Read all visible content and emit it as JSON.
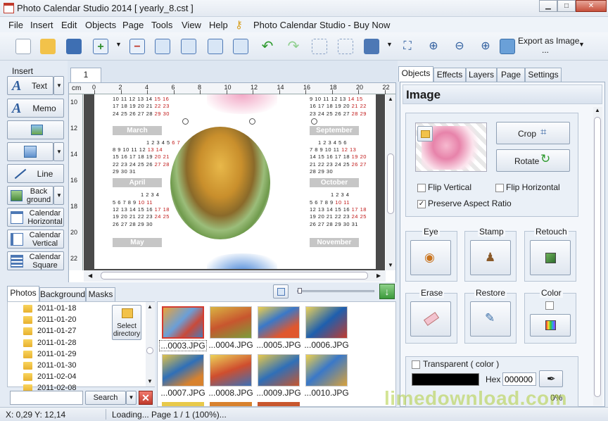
{
  "window": {
    "title": "Photo Calendar Studio 2014 [ yearly_8.cst ]",
    "buttons": {
      "minimize": "▁",
      "maximize": "□",
      "close": "✕"
    }
  },
  "menu": {
    "items": [
      "File",
      "Insert",
      "Edit",
      "Objects",
      "Page",
      "Tools",
      "View",
      "Help"
    ],
    "buy_now": "Photo Calendar Studio - Buy Now"
  },
  "toolbar": {
    "export_label": "Export as Image",
    "export_more": "..."
  },
  "insert_panel": {
    "title": "Insert",
    "text": "Text",
    "memo": "Memo",
    "line": "Line",
    "background": "Back ground",
    "cal_horizontal": "Calendar Horizontal",
    "cal_vertical": "Calendar Vertical",
    "cal_square": "Calendar Square"
  },
  "canvas": {
    "page_tab": "1",
    "ruler_unit": "cm",
    "ruler_ticks": [
      "0",
      "2",
      "4",
      "6",
      "8",
      "10",
      "12",
      "14",
      "16",
      "18",
      "20",
      "22"
    ],
    "ruler_v_ticks": [
      "10",
      "12",
      "14",
      "16",
      "18",
      "20",
      "22"
    ],
    "left_months": {
      "top_rows": [
        "10 11 12 13 14 15 16",
        "17 18 19 20 21 22 23",
        "24 25 26 27 28 29 30"
      ],
      "march": {
        "name": "March",
        "rows": [
          "1 2 3 4 5 6 7",
          "8 9 10 11 12 13 14",
          "15 16 17 18 19 20 21",
          "22 23 24 25 26 27 28",
          "29 30 31"
        ]
      },
      "april": {
        "name": "April",
        "rows": [
          "1 2 3 4",
          "5 6 7 8 9 10 11",
          "12 13 14 15 16 17 18",
          "19 20 21 22 23 24 25",
          "26 27 28 29 30"
        ]
      },
      "may": {
        "name": "May"
      }
    },
    "right_months": {
      "top_rows": [
        "9 10 11 12 13 14 15",
        "16 17 18 19 20 21 22",
        "23 24 25 26 27 28 29"
      ],
      "september": {
        "name": "September",
        "rows": [
          "1 2 3 4 5 6",
          "7 8 9 10 11 12 13",
          "14 15 16 17 18 19 20",
          "21 22 23 24 25 26 27",
          "28 29 30"
        ]
      },
      "october": {
        "name": "October",
        "rows": [
          "1 2 3 4",
          "5 6 7 8 9 10 11",
          "12 13 14 15 16 17 18",
          "19 20 21 22 23 24 25",
          "26 27 28 29 30 31"
        ]
      },
      "november": {
        "name": "November"
      }
    }
  },
  "bottom": {
    "tabs": [
      "Photos",
      "Background",
      "Masks"
    ],
    "folders": [
      "2011-01-18",
      "2011-01-20",
      "2011-01-27",
      "2011-01-28",
      "2011-01-29",
      "2011-01-30",
      "2011-02-04",
      "2011-02-08"
    ],
    "select_directory": "Select directory",
    "search_button": "Search",
    "search_value": "",
    "thumbnails": [
      "...0003.JPG",
      "...0004.JPG",
      "...0005.JPG",
      "...0006.JPG",
      "...0007.JPG",
      "...0008.JPG",
      "...0009.JPG",
      "...0010.JPG"
    ]
  },
  "right_panel": {
    "tabs": [
      "Objects",
      "Effects",
      "Layers",
      "Page",
      "Settings"
    ],
    "heading": "Image",
    "crop": "Crop",
    "rotate": "Rotate",
    "flip_vertical": "Flip Vertical",
    "flip_horizontal": "Flip Horizontal",
    "preserve_aspect": "Preserve Aspect Ratio",
    "preserve_checked": true,
    "eye": "Eye",
    "stamp": "Stamp",
    "retouch": "Retouch",
    "erase": "Erase",
    "restore": "Restore",
    "color": "Color",
    "transparent": "Transparent ( color )",
    "hex_label": "Hex",
    "hex_value": "000000",
    "percent": "0%"
  },
  "status": {
    "coords": "X: 0,29 Y: 12,14",
    "message": "Loading... Page 1 / 1 (100%)..."
  },
  "watermark": "limedownload.com",
  "colors": {
    "accent": "#2f5e9e",
    "weekend": "#c01717",
    "month_bar": "#c6c6c6"
  }
}
